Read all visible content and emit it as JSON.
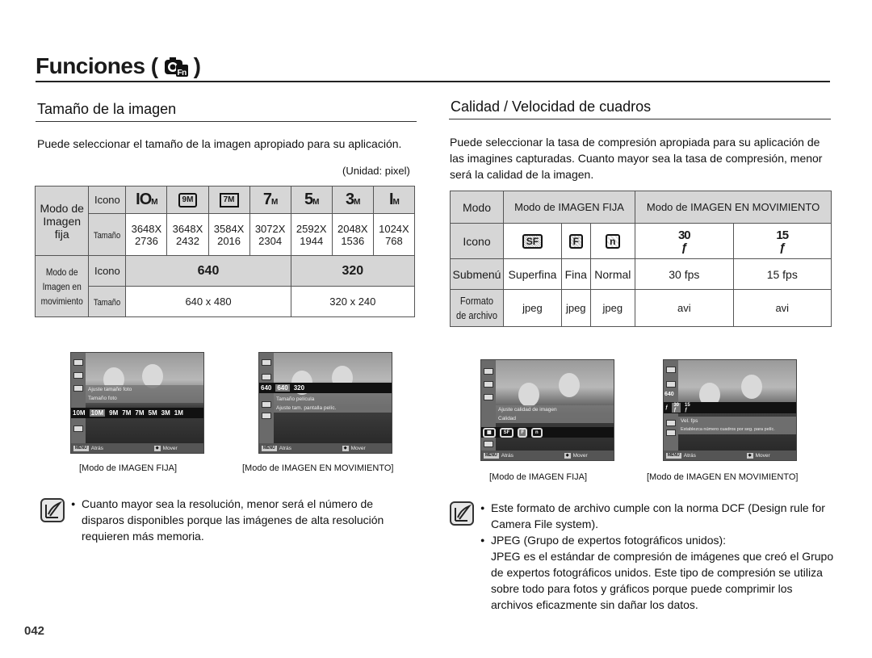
{
  "page": {
    "title": "Funciones (",
    "title_close": ")",
    "title_icon": "camera-fn-icon",
    "page_number": "042"
  },
  "left": {
    "section_title": "Tamaño de la imagen",
    "intro": "Puede seleccionar el tamaño de la imagen apropiado para su aplicación.",
    "unit_note": "(Unidad: pixel)",
    "table": {
      "still_mode_label": "Modo de Imagen fija",
      "movie_mode_label": "Modo de Imagen en movimiento",
      "icon_label": "Icono",
      "size_label": "Tamaño",
      "still_icons": [
        "10M",
        "9M",
        "7M",
        "7M",
        "5M",
        "3M",
        "1M"
      ],
      "still_sizes": [
        {
          "w": "3648X",
          "h": "2736"
        },
        {
          "w": "3648X",
          "h": "2432"
        },
        {
          "w": "3584X",
          "h": "2016"
        },
        {
          "w": "3072X",
          "h": "2304"
        },
        {
          "w": "2592X",
          "h": "1944"
        },
        {
          "w": "2048X",
          "h": "1536"
        },
        {
          "w": "1024X",
          "h": "768"
        }
      ],
      "movie_icons": [
        "640",
        "320"
      ],
      "movie_sizes": [
        "640 x 480",
        "320 x 240"
      ]
    },
    "screens": [
      {
        "caption": "[Modo de IMAGEN FIJA]",
        "line1": "Ajuste tamaño foto",
        "line2": "Tamaño foto",
        "options": [
          "10M",
          "10M",
          "9M",
          "7M",
          "7M",
          "5M",
          "3M",
          "1M"
        ],
        "back": "Atrás",
        "move": "Mover",
        "menu_key": "MENU"
      },
      {
        "caption": "[Modo de IMAGEN EN MOVIMIENTO]",
        "line1": "Tamaño película",
        "line2": "Ajuste tam. pantalla pelíc.",
        "options": [
          "640",
          "640",
          "320"
        ],
        "back": "Atrás",
        "move": "Mover",
        "menu_key": "MENU"
      }
    ],
    "note": "Cuanto mayor sea la resolución, menor será el número de disparos disponibles porque las imágenes de alta resolución requieren más memoria."
  },
  "right": {
    "section_title": "Calidad / Velocidad de cuadros",
    "intro": "Puede seleccionar la tasa de compresión apropiada para su aplicación de las imagines capturadas. Cuanto mayor sea la tasa de compresión, menor será la calidad de la imagen.",
    "table": {
      "mode_label": "Modo",
      "still_mode": "Modo de IMAGEN FIJA",
      "movie_mode": "Modo de IMAGEN EN MOVIMIENTO",
      "icon_label": "Icono",
      "submenu_label": "Submenú",
      "format_label": "Formato de archivo",
      "icons": [
        "SF",
        "F",
        "N",
        "30",
        "15"
      ],
      "submenus": [
        "Superfina",
        "Fina",
        "Normal",
        "30 fps",
        "15 fps"
      ],
      "formats": [
        "jpeg",
        "jpeg",
        "jpeg",
        "avi",
        "avi"
      ]
    },
    "screens": [
      {
        "caption": "[Modo de IMAGEN FIJA]",
        "line1": "Ajuste calidad de imagen",
        "line2": "Calidad",
        "back": "Atrás",
        "move": "Mover",
        "menu_key": "MENU"
      },
      {
        "caption": "[Modo de IMAGEN EN MOVIMIENTO]",
        "line1": "Vel. fps",
        "line2": "Establezca número cuadros por seg. para pelíc.",
        "badge": "640",
        "back": "Atrás",
        "move": "Mover",
        "menu_key": "MENU"
      }
    ],
    "notes": [
      "Este formato de archivo cumple con la norma DCF (Design rule for Camera File system).",
      "JPEG (Grupo de expertos fotográficos unidos):"
    ],
    "jpeg_desc": "JPEG es el estándar de compresión de imágenes que creó el Grupo de expertos fotográficos unidos. Este tipo de compresión se utiliza sobre todo para fotos y gráficos porque puede comprimir los archivos eficazmente sin dañar los datos."
  }
}
